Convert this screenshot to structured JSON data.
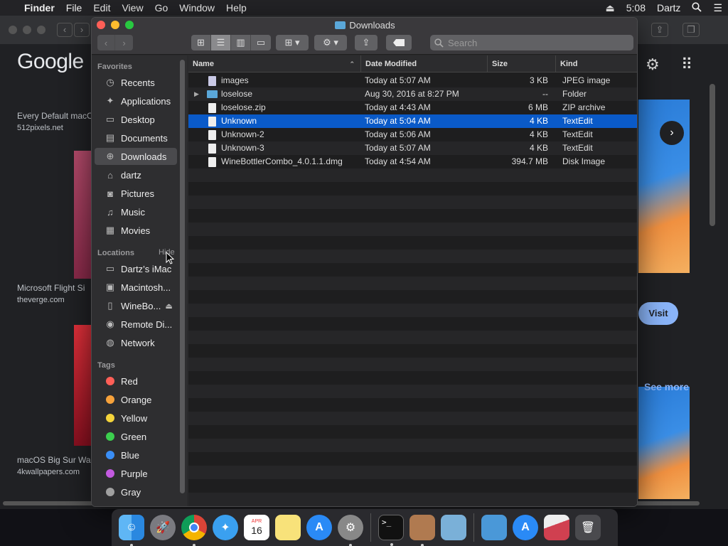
{
  "menubar": {
    "apple": "",
    "app": "Finder",
    "menus": [
      "File",
      "Edit",
      "View",
      "Go",
      "Window",
      "Help"
    ],
    "time": "5:08",
    "user": "Dartz"
  },
  "browser": {
    "logo": "Google",
    "results": [
      {
        "title": "Every Default macO",
        "source": "512pixels.net"
      },
      {
        "title": "Microsoft Flight Si",
        "source": "theverge.com"
      },
      {
        "title": "macOS Big Sur Wa",
        "source": "4kwallpapers.com"
      }
    ],
    "visit": "Visit",
    "see_more": "See more"
  },
  "finder": {
    "title": "Downloads",
    "search_placeholder": "Search",
    "sidebar": {
      "favorites_header": "Favorites",
      "favorites": [
        {
          "label": "Recents",
          "icon": "clock-icon"
        },
        {
          "label": "Applications",
          "icon": "applications-icon"
        },
        {
          "label": "Desktop",
          "icon": "desktop-icon"
        },
        {
          "label": "Documents",
          "icon": "document-icon"
        },
        {
          "label": "Downloads",
          "icon": "download-icon"
        },
        {
          "label": "dartz",
          "icon": "home-icon"
        },
        {
          "label": "Pictures",
          "icon": "camera-icon"
        },
        {
          "label": "Music",
          "icon": "music-icon"
        },
        {
          "label": "Movies",
          "icon": "film-icon"
        }
      ],
      "locations_header": "Locations",
      "hide": "Hide",
      "locations": [
        {
          "label": "Dartz’s iMac",
          "icon": "imac-icon"
        },
        {
          "label": "Macintosh...",
          "icon": "disk-icon"
        },
        {
          "label": "WineBo...",
          "icon": "volume-icon"
        },
        {
          "label": "Remote Di...",
          "icon": "remote-disc-icon"
        },
        {
          "label": "Network",
          "icon": "network-icon"
        }
      ],
      "tags_header": "Tags",
      "tags": [
        {
          "label": "Red",
          "color": "#ff5f57"
        },
        {
          "label": "Orange",
          "color": "#f7a23b"
        },
        {
          "label": "Yellow",
          "color": "#f4d43b"
        },
        {
          "label": "Green",
          "color": "#3ccf4e"
        },
        {
          "label": "Blue",
          "color": "#3a8ef6"
        },
        {
          "label": "Purple",
          "color": "#c35ae0"
        },
        {
          "label": "Gray",
          "color": "#a0a0a0"
        }
      ]
    },
    "columns": {
      "name": "Name",
      "date": "Date Modified",
      "size": "Size",
      "kind": "Kind"
    },
    "files": [
      {
        "name": "images",
        "date": "Today at 5:07 AM",
        "size": "3 KB",
        "kind": "JPEG image",
        "icon": "image-file-icon"
      },
      {
        "name": "loselose",
        "date": "Aug 30, 2016 at 8:27 PM",
        "size": "--",
        "kind": "Folder",
        "icon": "folder-icon"
      },
      {
        "name": "loselose.zip",
        "date": "Today at 4:43 AM",
        "size": "6 MB",
        "kind": "ZIP archive",
        "icon": "zip-file-icon"
      },
      {
        "name": "Unknown",
        "date": "Today at 5:04 AM",
        "size": "4 KB",
        "kind": "TextEdit",
        "icon": "text-file-icon"
      },
      {
        "name": "Unknown-2",
        "date": "Today at 5:06 AM",
        "size": "4 KB",
        "kind": "TextEdit",
        "icon": "text-file-icon"
      },
      {
        "name": "Unknown-3",
        "date": "Today at 5:07 AM",
        "size": "4 KB",
        "kind": "TextEdit",
        "icon": "text-file-icon"
      },
      {
        "name": "WineBottlerCombo_4.0.1.1.dmg",
        "date": "Today at 4:54 AM",
        "size": "394.7 MB",
        "kind": "Disk Image",
        "icon": "dmg-file-icon"
      }
    ]
  },
  "dock": {
    "apps": [
      "finder-icon",
      "launchpad-icon",
      "chrome-icon",
      "safari-icon",
      "calendar-icon",
      "notes-icon",
      "app-store-icon",
      "system-preferences-icon",
      "terminal-icon",
      "archive-utility-icon",
      "preview-icon",
      "folder-icon",
      "app-store-icon",
      "disk-image-icon",
      "trash-icon"
    ],
    "calendar_month": "APR",
    "calendar_day": "16"
  }
}
